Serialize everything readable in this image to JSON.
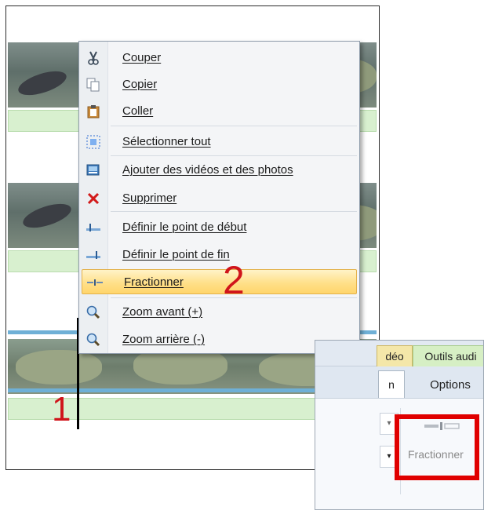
{
  "context_menu": {
    "items": [
      {
        "label": "Couper",
        "icon": "scissors-icon"
      },
      {
        "label": "Copier",
        "icon": "copy-icon"
      },
      {
        "label": "Coller",
        "icon": "paste-icon"
      },
      {
        "label": "Sélectionner tout",
        "icon": "select-all-icon"
      },
      {
        "label": "Ajouter des vidéos et des photos",
        "icon": "add-media-icon"
      },
      {
        "label": "Supprimer",
        "icon": "delete-icon"
      },
      {
        "label": "Définir le point de début",
        "icon": "set-start-icon"
      },
      {
        "label": "Définir le point de fin",
        "icon": "set-end-icon"
      },
      {
        "label": "Fractionner",
        "icon": "split-icon",
        "highlighted": true
      },
      {
        "label": "Zoom avant (+)",
        "icon": "zoom-in-icon"
      },
      {
        "label": "Zoom arrière (-)",
        "icon": "zoom-out-icon"
      }
    ]
  },
  "annotations": {
    "step1": "1",
    "step2": "2",
    "color": "#d0141b"
  },
  "ribbon": {
    "tabs": {
      "video_partial": "déo",
      "audio_partial": "Outils audi"
    },
    "subtabs": {
      "partial": "n",
      "options": "Options"
    },
    "split_button_label": "Fractionner",
    "highlight_color": "#e00000"
  }
}
